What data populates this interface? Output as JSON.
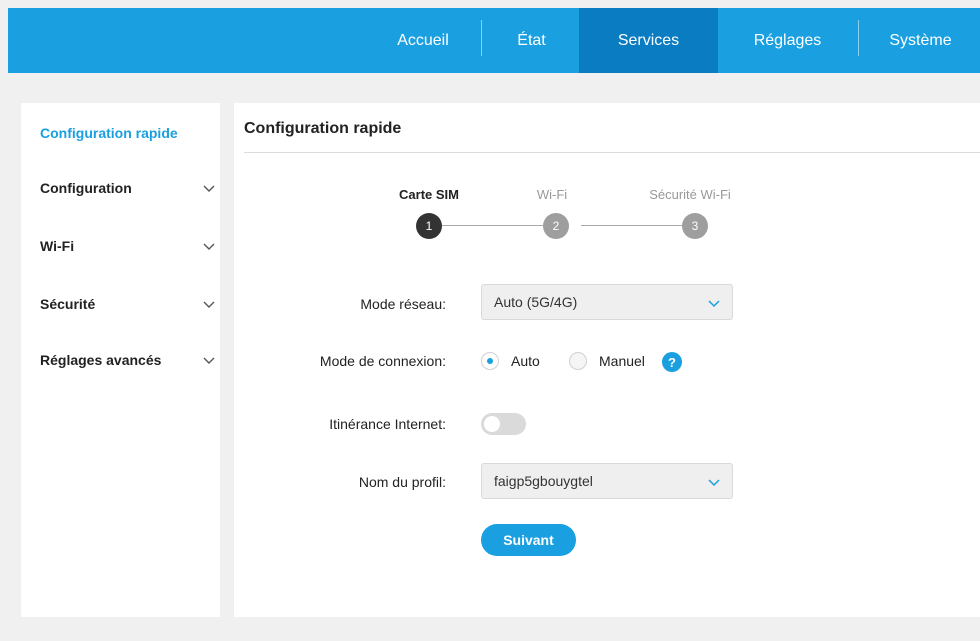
{
  "nav": {
    "items": [
      "Accueil",
      "État",
      "Services",
      "Réglages",
      "Système"
    ],
    "active": "Services"
  },
  "sidebar": {
    "items": [
      {
        "label": "Configuration rapide",
        "active": true,
        "expandable": false
      },
      {
        "label": "Configuration",
        "active": false,
        "expandable": true
      },
      {
        "label": "Wi-Fi",
        "active": false,
        "expandable": true
      },
      {
        "label": "Sécurité",
        "active": false,
        "expandable": true
      },
      {
        "label": "Réglages avancés",
        "active": false,
        "expandable": true
      }
    ]
  },
  "main": {
    "title": "Configuration rapide",
    "steps": [
      {
        "label": "Carte SIM",
        "number": "1",
        "current": true
      },
      {
        "label": "Wi-Fi",
        "number": "2",
        "current": false
      },
      {
        "label": "Sécurité Wi-Fi",
        "number": "3",
        "current": false
      }
    ],
    "network_mode": {
      "label": "Mode réseau:",
      "value": "Auto (5G/4G)"
    },
    "connection_mode": {
      "label": "Mode de connexion:",
      "options": [
        "Auto",
        "Manuel"
      ],
      "selected": "Auto",
      "help_icon": "?"
    },
    "roaming": {
      "label": "Itinérance Internet:",
      "enabled": false
    },
    "profile": {
      "label": "Nom du profil:",
      "value": "faigp5gbouygtel"
    },
    "next_button": "Suivant"
  },
  "colors": {
    "accent": "#1a9fe0",
    "nav_active": "#0a7cc1",
    "background": "#f0f0f0"
  },
  "icons": [
    "chevron-down-icon",
    "help-icon",
    "radio-selected",
    "toggle-off"
  ]
}
